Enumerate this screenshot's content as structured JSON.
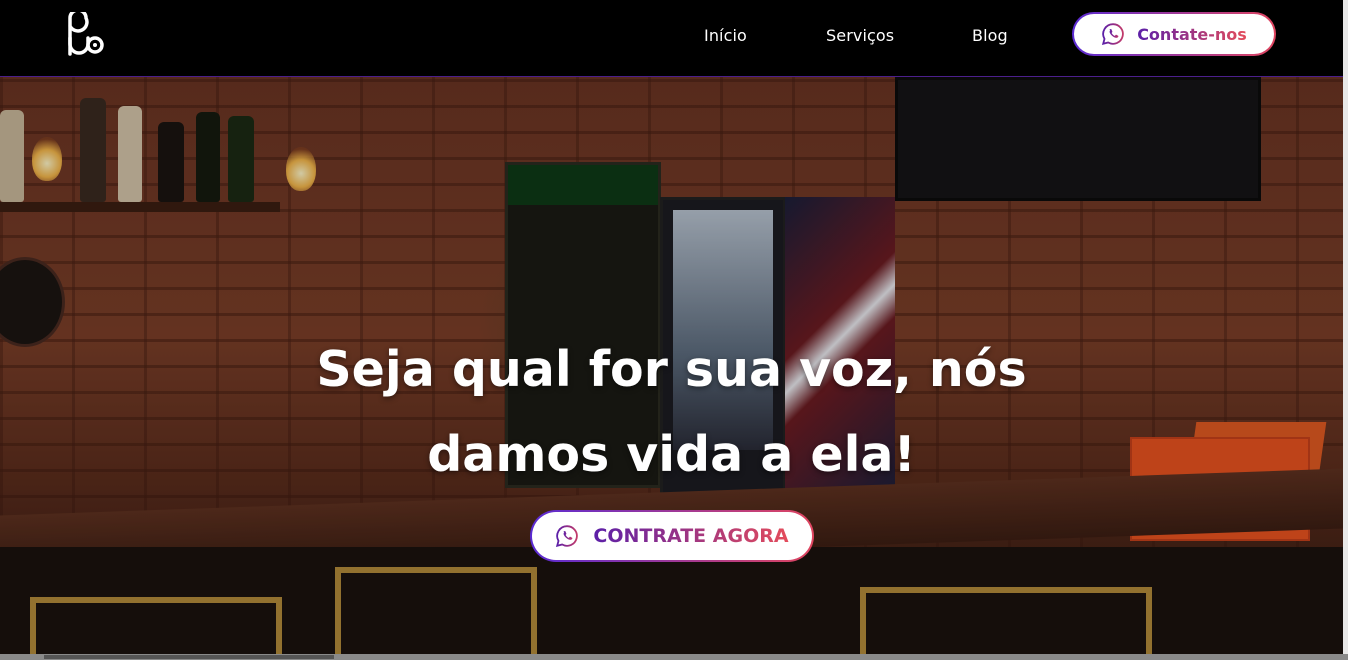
{
  "nav": {
    "logo_icon": "pb-logo-icon",
    "links": [
      {
        "label": "Início"
      },
      {
        "label": "Serviços"
      },
      {
        "label": "Blog"
      }
    ],
    "contact_button": {
      "label": "Contate-nos",
      "icon": "whatsapp-icon"
    }
  },
  "hero": {
    "headline_line1": "Seja qual for sua voz, nós",
    "headline_line2": "damos vida a ela!",
    "cta_button": {
      "label": "CONTRATE AGORA",
      "icon": "whatsapp-icon"
    }
  },
  "colors": {
    "accent_purple": "#5a2bd3",
    "accent_coral": "#e0455f",
    "nav_background": "#000000"
  }
}
